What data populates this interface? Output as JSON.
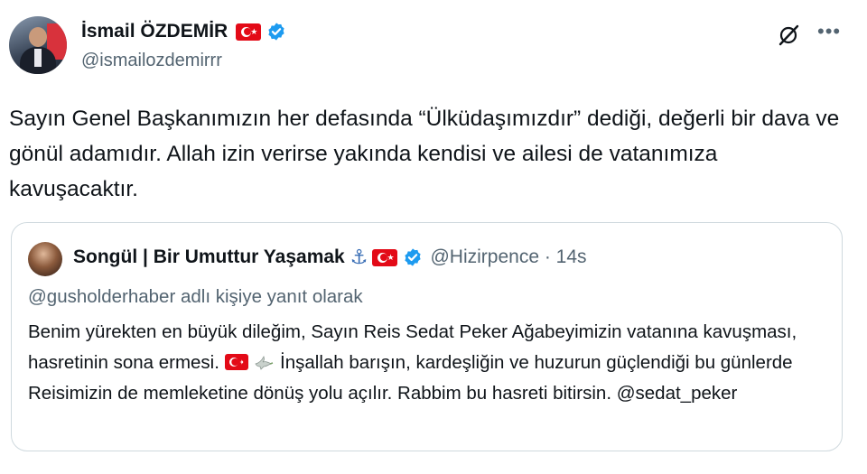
{
  "author": {
    "name": "İsmail ÖZDEMİR",
    "handle": "@ismailozdemirrr"
  },
  "tweet": {
    "text": "Sayın Genel Başkanımızın her defasında “Ülküdaşımızdır” dediği, değerli bir dava ve gönül adamıdır. Allah izin verirse yakında kendisi ve ailesi de vatanımıza kavuşacaktır."
  },
  "quote": {
    "name": "Songül | Bir Umuttur Yaşamak",
    "handle_time": "@Hizirpence · 14s",
    "reply_to": "@gusholderhaber adlı kişiye yanıt olarak",
    "text_part1": "Benim yürekten en büyük dileğim, Sayın Reis Sedat Peker Ağabeyimizin vatanına kavuşması, hasretinin sona ermesi. ",
    "text_part2": " İnşallah barışın, kardeşliğin ve huzurun güçlendiği bu günlerde Reisimizin de memleketine dönüş yolu açılır. Rabbim bu hasreti bitirsin.  @sedat_peker"
  },
  "icons": {
    "flag": "turkey-flag-emoji",
    "verified": "verified-badge-icon",
    "anchor": "anchor-emoji",
    "dove": "dove-emoji",
    "grok": "grok-icon",
    "more": "more-icon"
  },
  "colors": {
    "text": "#0f1419",
    "secondary": "#536471",
    "verified": "#1d9bf0",
    "flag_red": "#e30a17",
    "border": "#cfd9de"
  }
}
